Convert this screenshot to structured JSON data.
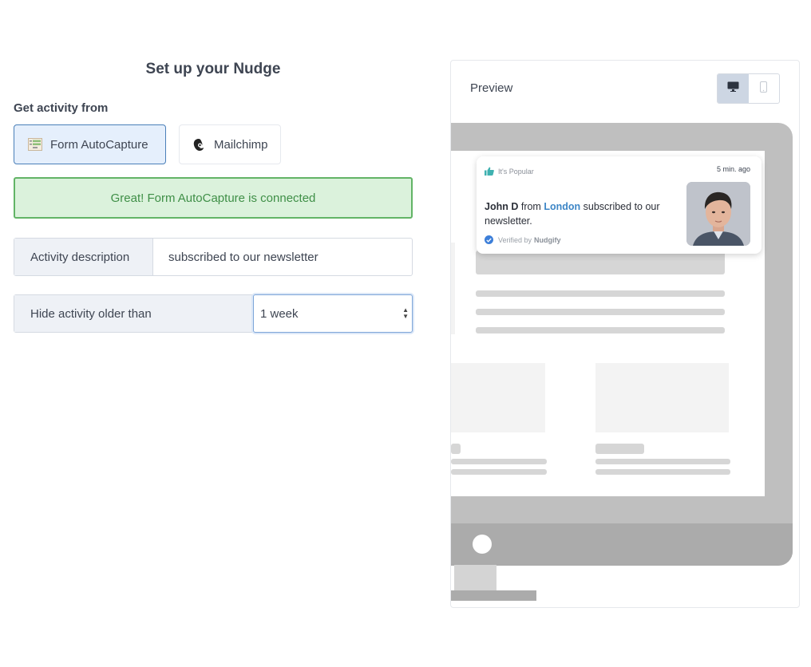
{
  "setup": {
    "title": "Set up your Nudge",
    "source_label": "Get activity from",
    "sources": [
      {
        "label": "Form AutoCapture",
        "icon": "form-icon",
        "active": true
      },
      {
        "label": "Mailchimp",
        "icon": "mailchimp-icon",
        "active": false
      }
    ],
    "alert": "Great! Form AutoCapture is connected",
    "activity_description": {
      "label": "Activity description",
      "value": "subscribed to our newsletter"
    },
    "hide_older": {
      "label": "Hide activity older than",
      "selected": "1 week"
    }
  },
  "preview": {
    "title": "Preview",
    "devices": [
      {
        "name": "desktop",
        "icon": "desktop-icon",
        "active": true
      },
      {
        "name": "mobile",
        "icon": "mobile-icon",
        "active": false
      }
    ],
    "notification": {
      "tag": "It's Popular",
      "time": "5 min. ago",
      "name": "John D",
      "from_word": "from",
      "city": "London",
      "action": "subscribed to our newsletter.",
      "verified_prefix": "Verified by",
      "verified_brand": "Nudgify"
    }
  },
  "colors": {
    "accent_blue": "#4a7fb8",
    "success_green": "#62b466",
    "success_bg": "#dbf2dc",
    "link_blue": "#3d86c6",
    "thumb_teal": "#3fb1b0"
  }
}
